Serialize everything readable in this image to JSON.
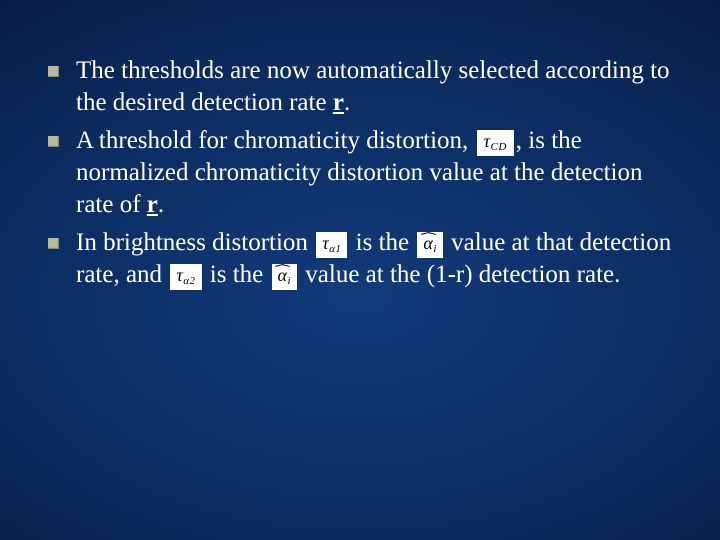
{
  "bullets": {
    "b1": {
      "pre": "The thresholds are now automatically selected according to the desired detection rate ",
      "r": "r",
      "post": "."
    },
    "b2": {
      "pre": "A threshold for chromaticity distortion, ",
      "sym_tau_cd": "τ",
      "sym_tau_cd_sub": "CD",
      "mid": ", is the normalized chromaticity distortion value at the detection rate of ",
      "r": "r",
      "post": "."
    },
    "b3": {
      "pre": "In brightness distortion ",
      "sym_tau_a1": "τ",
      "sym_tau_a1_sub": "α1",
      "mid1": " is the ",
      "sym_alpha_hat_1": "α",
      "sym_alpha_hat_1_sub": "i",
      "mid2": " value at that detection rate, and ",
      "sym_tau_a2": "τ",
      "sym_tau_a2_sub": "α2",
      "mid3": " is the ",
      "sym_alpha_hat_2": "α",
      "sym_alpha_hat_2_sub": "i",
      "mid4": " value at the (1-r) detection rate."
    }
  }
}
